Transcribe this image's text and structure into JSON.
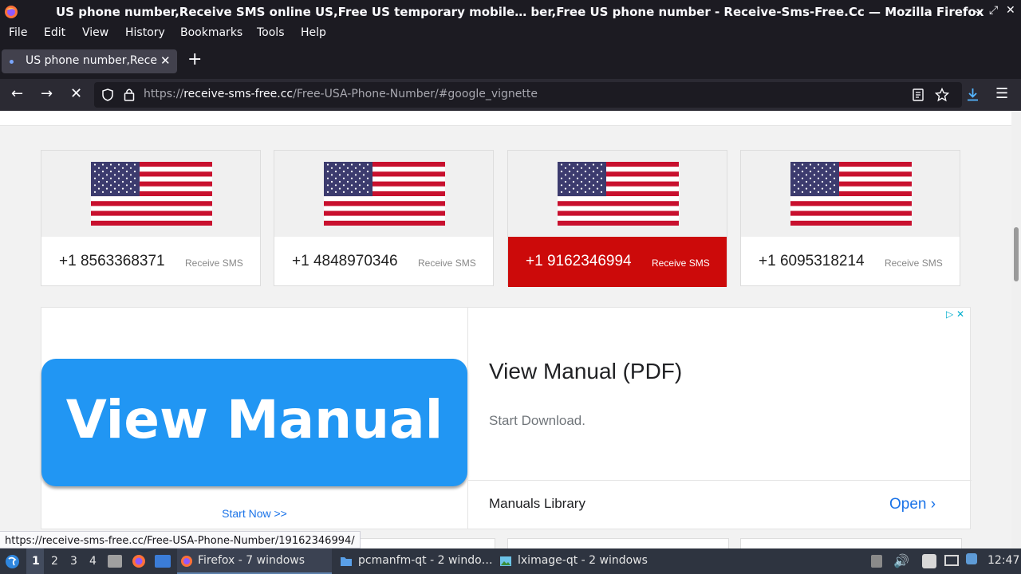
{
  "window": {
    "title": "US phone number,Receive SMS online US,Free US temporary mobile… ber,Free US phone number - Receive-Sms-Free.Cc — Mozilla Firefox"
  },
  "menu": [
    "File",
    "Edit",
    "View",
    "History",
    "Bookmarks",
    "Tools",
    "Help"
  ],
  "tab": {
    "title": "US phone number,Receive SMS online US"
  },
  "nav": {
    "url_scheme": "https://",
    "url_host": "receive-sms-free.cc",
    "url_path": "/Free-USA-Phone-Number/#google_vignette"
  },
  "numbers": [
    {
      "number": "+1 8563368371",
      "action": "Receive SMS",
      "active": false
    },
    {
      "number": "+1 4848970346",
      "action": "Receive SMS",
      "active": false
    },
    {
      "number": "+1 9162346994",
      "action": "Receive SMS",
      "active": true
    },
    {
      "number": "+1 6095318214",
      "action": "Receive SMS",
      "active": false
    }
  ],
  "ad": {
    "button_text": "View Manual",
    "start_link": "Start Now >>",
    "title": "View Manual (PDF)",
    "subtitle": "Start Download.",
    "library": "Manuals Library",
    "open": "Open"
  },
  "status_link": "https://receive-sms-free.cc/Free-USA-Phone-Number/19162346994/",
  "taskbar": {
    "workspaces": [
      "1",
      "2",
      "3",
      "4"
    ],
    "tasks": [
      {
        "label": "Firefox - 7 windows",
        "icon": "firefox-icon"
      },
      {
        "label": "pcmanfm-qt - 2 windo…",
        "icon": "folder-icon"
      },
      {
        "label": "lximage-qt - 2 windows",
        "icon": "image-viewer-icon"
      }
    ],
    "clock": "12:47"
  },
  "colors": {
    "active_card": "#cc0a0a",
    "ad_button": "#2196f3",
    "link": "#1a73e8"
  }
}
